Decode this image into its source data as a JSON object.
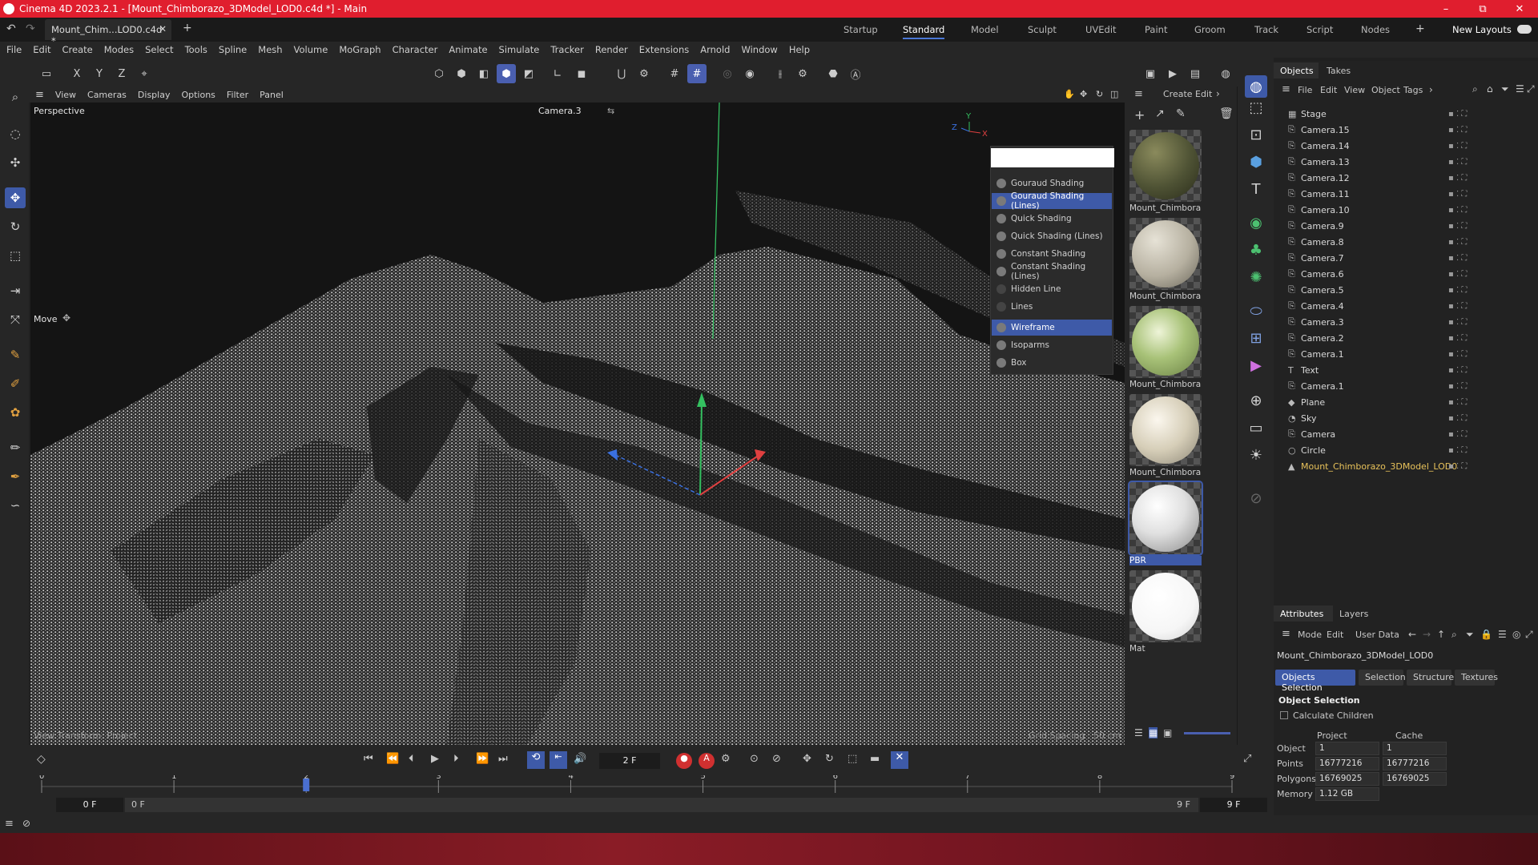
{
  "window": {
    "title": "Cinema 4D 2023.2.1 - [Mount_Chimborazo_3DModel_LOD0.c4d *] - Main",
    "controls": [
      "–",
      "⧉",
      "✕"
    ]
  },
  "document_tab": {
    "label": "Mount_Chim...LOD0.c4d *"
  },
  "layouts": {
    "items": [
      "Startup",
      "Standard",
      "Model",
      "Sculpt",
      "UVEdit",
      "Paint",
      "Groom",
      "Track",
      "Script",
      "Nodes"
    ],
    "active": "Standard",
    "new_layouts": "New Layouts"
  },
  "menu": [
    "File",
    "Edit",
    "Create",
    "Modes",
    "Select",
    "Tools",
    "Spline",
    "Mesh",
    "Volume",
    "MoGraph",
    "Character",
    "Animate",
    "Simulate",
    "Tracker",
    "Render",
    "Extensions",
    "Arnold",
    "Window",
    "Help"
  ],
  "axis_buttons": [
    "X",
    "Y",
    "Z"
  ],
  "viewport_menu": [
    "View",
    "Cameras",
    "Display",
    "Options",
    "Filter",
    "Panel"
  ],
  "viewport": {
    "name": "Perspective",
    "camera": "Camera.3",
    "tool": "Move",
    "bottom_left": "View Transform: Project",
    "bottom_right": "Grid Spacing : 50 cm"
  },
  "shading_menu": {
    "items": [
      "Gouraud Shading",
      "Gouraud Shading (Lines)",
      "Quick Shading",
      "Quick Shading (Lines)",
      "Constant Shading",
      "Constant Shading (Lines)",
      "Hidden Line",
      "Lines",
      "Wireframe",
      "Isoparms",
      "Box"
    ],
    "selected": [
      "Gouraud Shading (Lines)",
      "Wireframe"
    ]
  },
  "material_menu": [
    "Create",
    "Edit"
  ],
  "materials": [
    {
      "label": "Mount_Chimbora:",
      "color": "#5a5a3a"
    },
    {
      "label": "Mount_Chimbora:",
      "color": "#b8b4a6"
    },
    {
      "label": "Mount_Chimbora:",
      "color": "#a8c278"
    },
    {
      "label": "Mount_Chimbora:",
      "color": "#d6ceb8"
    },
    {
      "label": "PBR",
      "color": "#e8e8e8"
    },
    {
      "label": "Mat",
      "color": "#ffffff"
    }
  ],
  "objects_panel": {
    "tabs": [
      "Objects",
      "Takes"
    ],
    "menu": [
      "File",
      "Edit",
      "View",
      "Object",
      "Tags"
    ],
    "rows": [
      "Stage",
      "Camera.15",
      "Camera.14",
      "Camera.13",
      "Camera.12",
      "Camera.11",
      "Camera.10",
      "Camera.9",
      "Camera.8",
      "Camera.7",
      "Camera.6",
      "Camera.5",
      "Camera.4",
      "Camera.3",
      "Camera.2",
      "Camera.1",
      "Text",
      "Camera.1",
      "Plane",
      "Sky",
      "Camera",
      "Circle",
      "Mount_Chimborazo_3DModel_LOD0"
    ],
    "highlight_color": "#e8c25a"
  },
  "attributes": {
    "tabs": [
      "Attributes",
      "Layers"
    ],
    "menu": [
      "Mode",
      "Edit",
      "User Data"
    ],
    "object_name": "Mount_Chimborazo_3DModel_LOD0",
    "sub_tabs": [
      "Objects Selection",
      "Selection",
      "Structure",
      "Textures"
    ],
    "active_sub_tab": "Objects Selection",
    "section": "Object Selection",
    "calc_children": "Calculate Children",
    "col_project": "Project",
    "col_cache": "Cache",
    "rows": [
      {
        "label": "Object",
        "project": "1",
        "cache": "1"
      },
      {
        "label": "Points",
        "project": "16777216",
        "cache": "16777216"
      },
      {
        "label": "Polygons",
        "project": "16769025",
        "cache": "16769025"
      },
      {
        "label": "Memory",
        "project": "1.12 GB",
        "cache": ""
      }
    ]
  },
  "timeline": {
    "current_frame": "2 F",
    "start": "0 F",
    "range_start": "0 F",
    "range_end": "9 F",
    "end": "9 F",
    "ticks": [
      "0",
      "1",
      "2",
      "3",
      "4",
      "5",
      "6",
      "7",
      "8",
      "9"
    ],
    "playhead": 2,
    "max_frame": 9
  },
  "colors": {
    "accent": "#3e5aa8",
    "title_bar": "#e01e2e"
  }
}
